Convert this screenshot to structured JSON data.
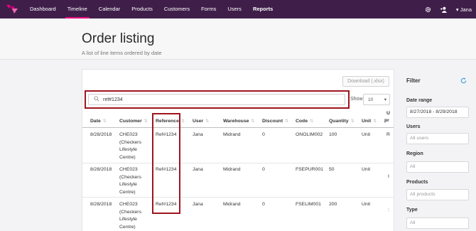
{
  "nav": {
    "items": [
      "Dashboard",
      "Timeline",
      "Calendar",
      "Products",
      "Customers",
      "Forms",
      "Users",
      "Reports"
    ],
    "active_index": 1,
    "bold_index": 7,
    "user_name": "Jana",
    "accent_color": "#e6007e",
    "bar_color": "#3f1f4a"
  },
  "page": {
    "title": "Order listing",
    "subtitle": "A list of line items ordered by date"
  },
  "toolbar": {
    "download_label": "Download (.xlsx)",
    "search_value": "ref#1234",
    "show_label": "Show",
    "show_value": "10"
  },
  "table": {
    "headers": [
      "Date",
      "Customer",
      "Reference",
      "User",
      "Warehouse",
      "Discount",
      "Code",
      "Quantity",
      "Unit",
      "U",
      "pr"
    ],
    "rows": [
      {
        "date": "8/28/2018",
        "customer": [
          "CHE023",
          "(Checkers",
          "Lifestyle",
          "Centre)"
        ],
        "reference": "Ref#1234",
        "user": "Jana",
        "warehouse": "Midrand",
        "discount": "0",
        "code": "ONOLIM002",
        "quantity": "100",
        "unit": "Unit",
        "price_partial": "R"
      },
      {
        "date": "8/28/2018",
        "customer": [
          "CHE023",
          "(Checkers",
          "Lifestyle",
          "Centre)"
        ],
        "reference": "Ref#1234",
        "user": "Jana",
        "warehouse": "Midrand",
        "discount": "0",
        "code": "FSEPUR001",
        "quantity": "50",
        "unit": "Unit",
        "price_partial": "I"
      },
      {
        "date": "8/28/2018",
        "customer": [
          "CHE023",
          "(Checkers",
          "Lifestyle",
          "Centre)"
        ],
        "reference": "Ref#1234",
        "user": "Jana",
        "warehouse": "Midrand",
        "discount": "0",
        "code": "FSELIM001",
        "quantity": "200",
        "unit": "Unit",
        "price_partial": ":"
      }
    ]
  },
  "filter": {
    "title": "Filter",
    "date_range_label": "Date range",
    "date_range_value": "8/27/2018 - 8/29/2018",
    "users_label": "Users",
    "users_placeholder": "All users",
    "region_label": "Region",
    "region_placeholder": "All",
    "products_label": "Products",
    "products_placeholder": "All products",
    "type_label": "Type",
    "type_placeholder": "All"
  },
  "highlight_color": "#a0141e"
}
